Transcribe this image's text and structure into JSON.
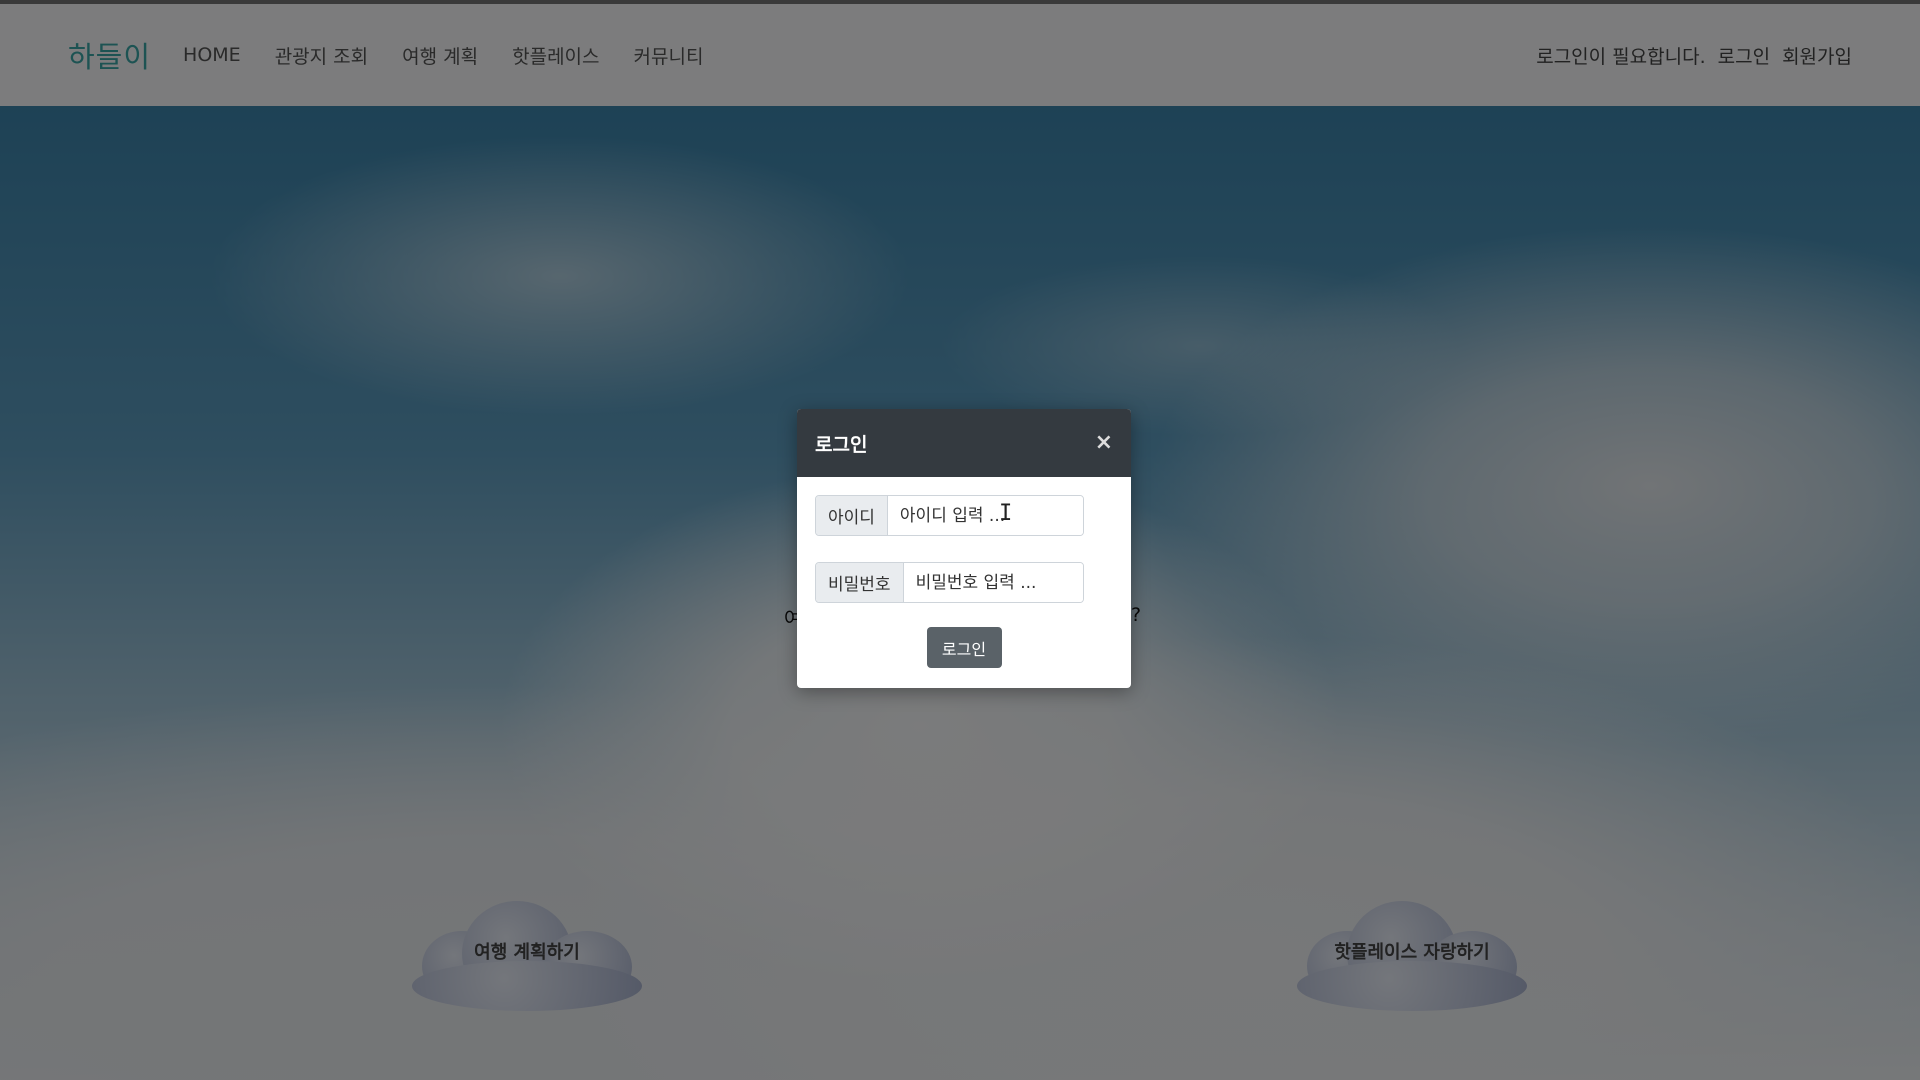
{
  "navbar": {
    "brand": "하들이",
    "items": [
      {
        "label": "HOME"
      },
      {
        "label": "관광지 조회"
      },
      {
        "label": "여행 계획"
      },
      {
        "label": "핫플레이스"
      },
      {
        "label": "커뮤니티"
      }
    ],
    "status": "로그인이 필요합니다.",
    "login_link": "로그인",
    "signup_link": "회원가입"
  },
  "hero": {
    "left_fragment": "여",
    "right_fragment": "?",
    "cloud_left": "여행 계획하기",
    "cloud_right": "핫플레이스 자랑하기"
  },
  "modal": {
    "title": "로그인",
    "close_symbol": "×",
    "id_label": "아이디",
    "id_placeholder": "아이디 입력 ...",
    "pw_label": "비밀번호",
    "pw_placeholder": "비밀번호 입력 ...",
    "submit": "로그인"
  },
  "icons": {
    "close": "close-icon",
    "cursor": "text-cursor-icon"
  }
}
